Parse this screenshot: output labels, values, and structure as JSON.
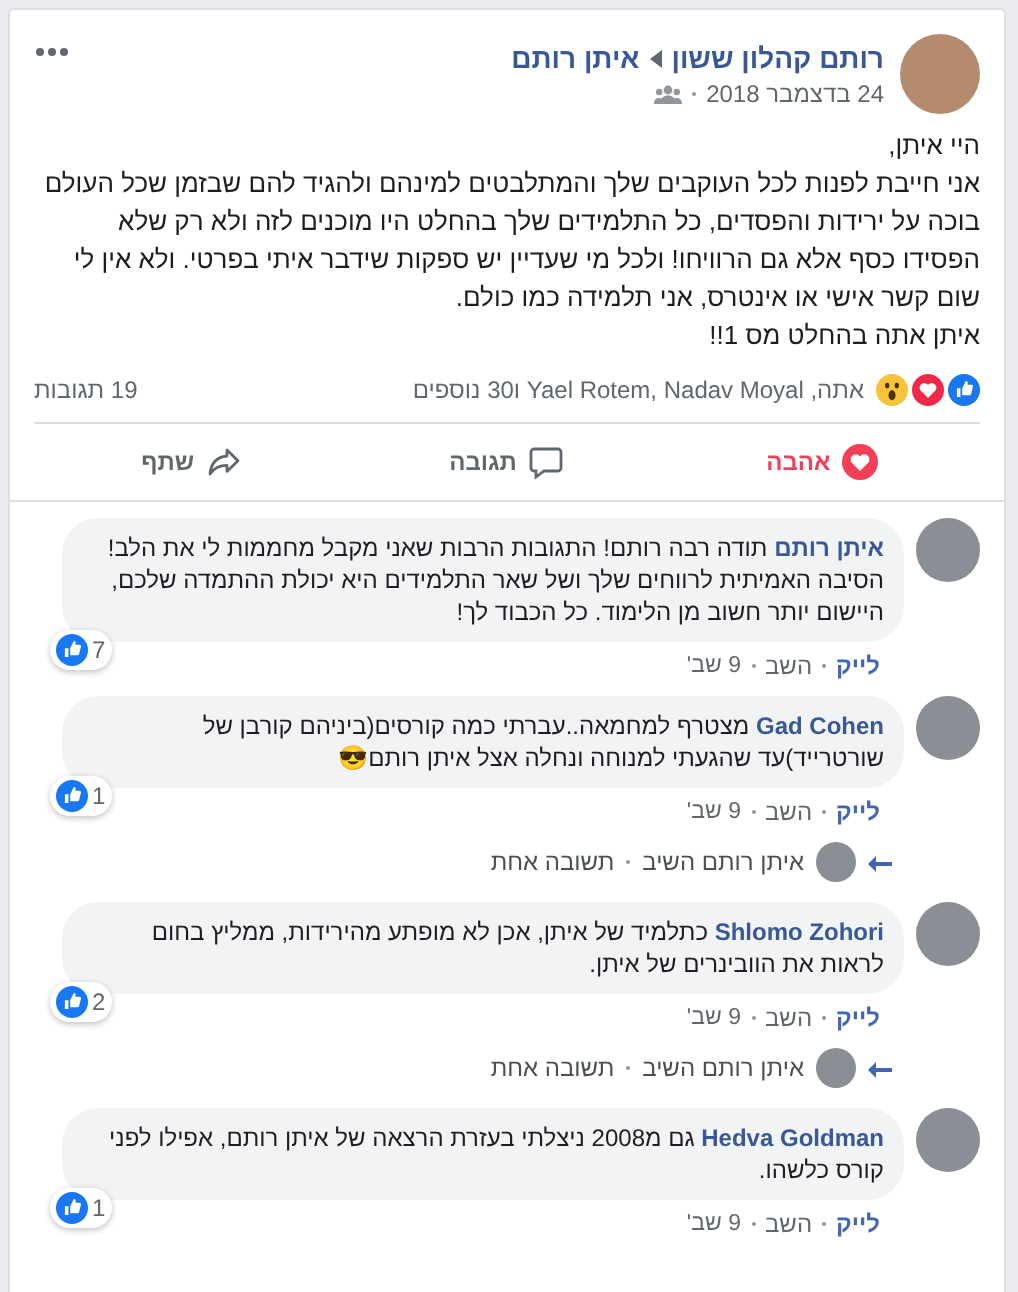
{
  "post": {
    "author": "רותם קהלון ששון",
    "target": "איתן רותם",
    "date": "24 בדצמבר 2018",
    "body": [
      "היי איתן,",
      "אני חייבת לפנות לכל העוקבים שלך והמתלבטים למינהם ולהגיד להם שבזמן שכל העולם בוכה על ירידות והפסדים, כל התלמידים שלך בהחלט היו מוכנים לזה ולא רק שלא הפסידו כסף אלא גם הרוויחו! ולכל מי שעדיין יש ספקות שידבר איתי בפרטי. ולא אין לי שום קשר אישי או אינטרס, אני תלמידה כמו כולם.",
      "איתן אתה בהחלט מס 1!!"
    ],
    "reactions": {
      "types": [
        {
          "kind": "like"
        },
        {
          "kind": "love"
        },
        {
          "kind": "wow"
        }
      ],
      "summary": "אתה, Yael Rotem, Nadav Moyal ו30 נוספים"
    },
    "comment_count": "19 תגובות"
  },
  "actions": [
    {
      "kind": "love",
      "label": "אהבה",
      "selected": true
    },
    {
      "kind": "comment",
      "label": "תגובה",
      "selected": false
    },
    {
      "kind": "share",
      "label": "שתף",
      "selected": false
    }
  ],
  "comments": [
    {
      "author": "איתן רותם",
      "text": "תודה רבה רותם! התגובות הרבות שאני מקבל מחממות לי את הלב! הסיבה האמיתית לרווחים שלך ושל שאר התלמידים היא יכולת ההתמדה שלכם, היישום יותר חשוב מן הלימוד. כל הכבוד לך!",
      "likes": "7",
      "liked": true,
      "like_label": "לייק",
      "reply_label": "השב",
      "time": "9 שב'"
    },
    {
      "author": "Gad Cohen",
      "text": "מצטרף למחמאה..עברתי כמה קורסים(ביניהם קורבן של שורטרייד)עד שהגעתי למנוחה ונחלה אצל איתן רותם😎",
      "likes": "1",
      "liked": true,
      "like_label": "לייק",
      "reply_label": "השב",
      "time": "9 שב'",
      "reply_summary": {
        "author": "איתן רותם השיב",
        "count": "תשובה אחת"
      }
    },
    {
      "author": "Shlomo Zohori",
      "text": "כתלמיד של איתן, אכן לא מופתע מהירידות, ממליץ בחום לראות את הוובינרים של איתן.",
      "likes": "2",
      "liked": true,
      "like_label": "לייק",
      "reply_label": "השב",
      "time": "9 שב'",
      "reply_summary": {
        "author": "איתן רותם השיב",
        "count": "תשובה אחת"
      }
    },
    {
      "author": "Hedva Goldman",
      "text": "גם מ2008 ניצלתי בעזרת הרצאה של איתן רותם, אפילו לפני קורס כלשהו.",
      "likes": "1",
      "liked": true,
      "like_label": "לייק",
      "reply_label": "השב",
      "time": "9 שב'"
    }
  ]
}
